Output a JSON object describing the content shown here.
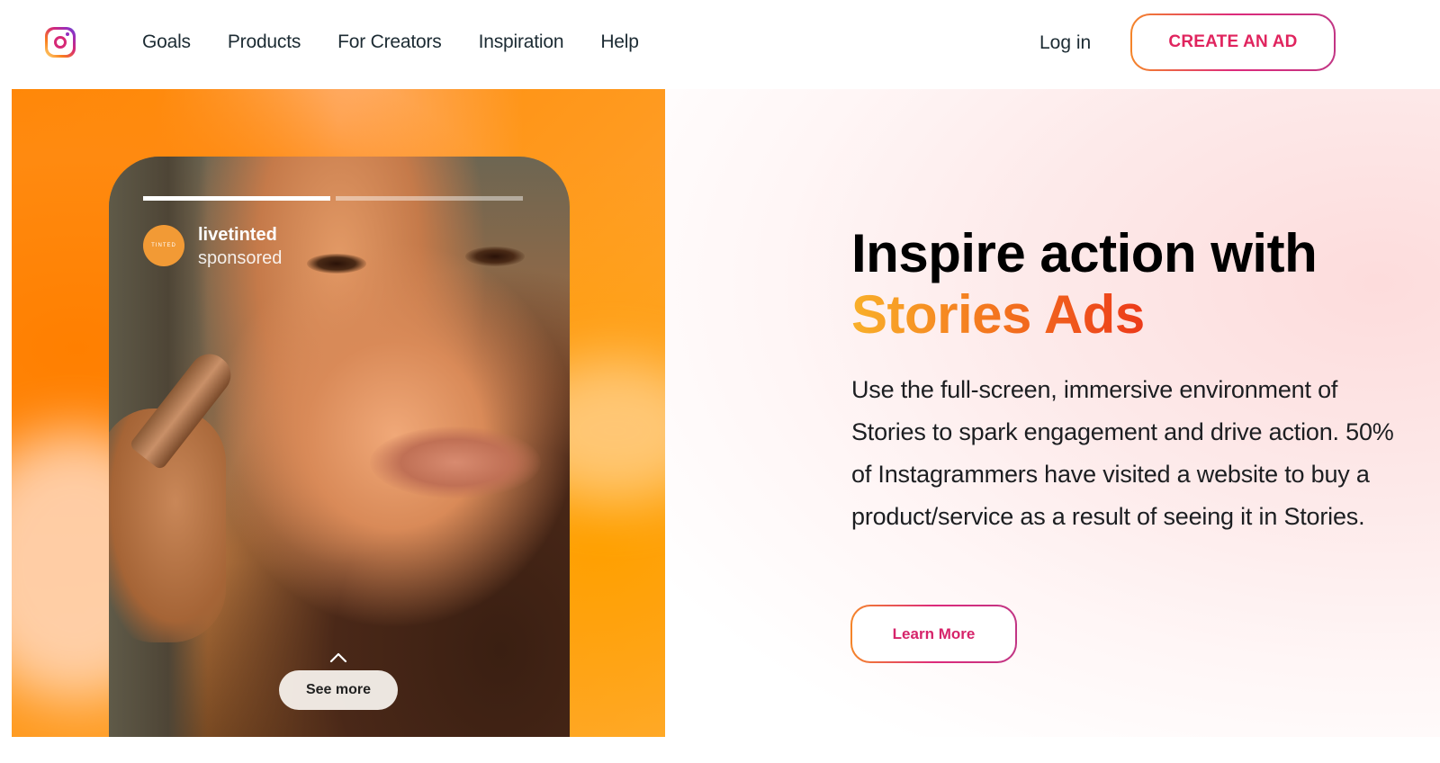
{
  "nav": {
    "logo_icon": "instagram-logo-icon",
    "links": [
      {
        "label": "Goals"
      },
      {
        "label": "Products"
      },
      {
        "label": "For Creators"
      },
      {
        "label": "Inspiration"
      },
      {
        "label": "Help"
      }
    ],
    "login_label": "Log in",
    "cta_label": "CREATE AN AD"
  },
  "story": {
    "brand_name": "livetinted",
    "brand_sub": "sponsored",
    "brand_avatar_text": "TINTED",
    "progress_segments": [
      1.0,
      0.0
    ],
    "see_more_label": "See more",
    "chevron_icon": "chevron-up-icon"
  },
  "hero": {
    "headline_line1": "Inspire action with",
    "headline_accent": "Stories Ads",
    "body": "Use the full-screen, immersive environment of Stories to spark engagement and drive action. 50% of Instagrammers have visited a website to buy a product/service as a result of seeing it in Stories.",
    "learn_more_label": "Learn More"
  },
  "colors": {
    "accent_pink": "#e0245e",
    "gradient_start": "#f58529",
    "gradient_end": "#c13584",
    "headline_accent_start": "#f9b02a",
    "headline_accent_end": "#ec3a1a"
  }
}
